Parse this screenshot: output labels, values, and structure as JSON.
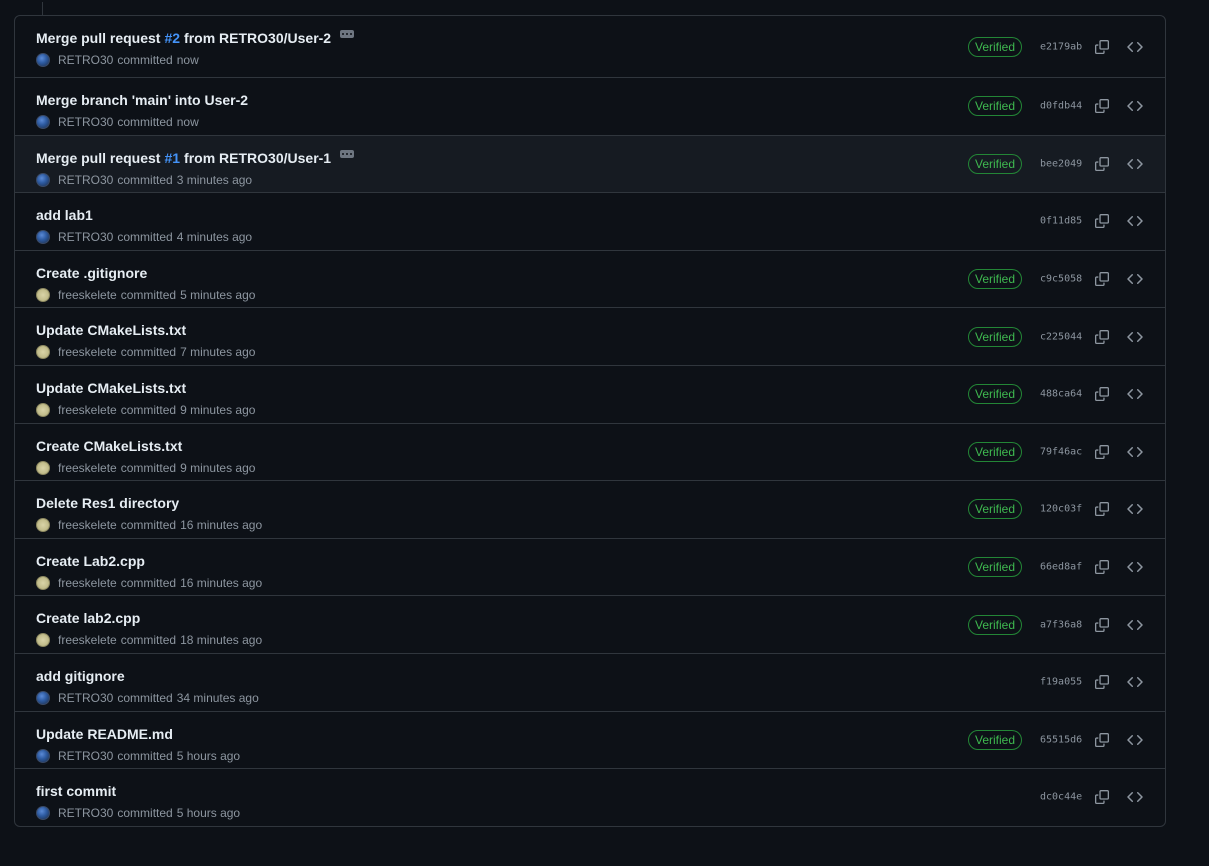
{
  "commits": [
    {
      "title_before": "Merge pull request",
      "pr_number": "#2",
      "title_after": "from RETRO30/User-2",
      "has_ellipsis": true,
      "author": "RETRO30",
      "avatar": "retro",
      "verb": "committed",
      "when": "now",
      "verified": "Verified",
      "sha": "e2179ab"
    },
    {
      "title_before": "Merge branch 'main' into User-2",
      "pr_number": "",
      "title_after": "",
      "has_ellipsis": false,
      "author": "RETRO30",
      "avatar": "retro",
      "verb": "committed",
      "when": "now",
      "verified": "Verified",
      "sha": "d0fdb44"
    },
    {
      "title_before": "Merge pull request",
      "pr_number": "#1",
      "title_after": "from RETRO30/User-1",
      "has_ellipsis": true,
      "author": "RETRO30",
      "avatar": "retro",
      "verb": "committed",
      "when": "3 minutes ago",
      "verified": "Verified",
      "sha": "bee2049",
      "hovered": true
    },
    {
      "title_before": "add lab1",
      "pr_number": "",
      "title_after": "",
      "has_ellipsis": false,
      "author": "RETRO30",
      "avatar": "retro",
      "verb": "committed",
      "when": "4 minutes ago",
      "verified": "",
      "sha": "0f11d85"
    },
    {
      "title_before": "Create .gitignore",
      "pr_number": "",
      "title_after": "",
      "has_ellipsis": false,
      "author": "freeskelete",
      "avatar": "free",
      "verb": "committed",
      "when": "5 minutes ago",
      "verified": "Verified",
      "sha": "c9c5058"
    },
    {
      "title_before": "Update CMakeLists.txt",
      "pr_number": "",
      "title_after": "",
      "has_ellipsis": false,
      "author": "freeskelete",
      "avatar": "free",
      "verb": "committed",
      "when": "7 minutes ago",
      "verified": "Verified",
      "sha": "c225044"
    },
    {
      "title_before": "Update CMakeLists.txt",
      "pr_number": "",
      "title_after": "",
      "has_ellipsis": false,
      "author": "freeskelete",
      "avatar": "free",
      "verb": "committed",
      "when": "9 minutes ago",
      "verified": "Verified",
      "sha": "488ca64"
    },
    {
      "title_before": "Create CMakeLists.txt",
      "pr_number": "",
      "title_after": "",
      "has_ellipsis": false,
      "author": "freeskelete",
      "avatar": "free",
      "verb": "committed",
      "when": "9 minutes ago",
      "verified": "Verified",
      "sha": "79f46ac"
    },
    {
      "title_before": "Delete Res1 directory",
      "pr_number": "",
      "title_after": "",
      "has_ellipsis": false,
      "author": "freeskelete",
      "avatar": "free",
      "verb": "committed",
      "when": "16 minutes ago",
      "verified": "Verified",
      "sha": "120c03f"
    },
    {
      "title_before": "Create Lab2.cpp",
      "pr_number": "",
      "title_after": "",
      "has_ellipsis": false,
      "author": "freeskelete",
      "avatar": "free",
      "verb": "committed",
      "when": "16 minutes ago",
      "verified": "Verified",
      "sha": "66ed8af"
    },
    {
      "title_before": "Create lab2.cpp",
      "pr_number": "",
      "title_after": "",
      "has_ellipsis": false,
      "author": "freeskelete",
      "avatar": "free",
      "verb": "committed",
      "when": "18 minutes ago",
      "verified": "Verified",
      "sha": "a7f36a8"
    },
    {
      "title_before": "add gitignore",
      "pr_number": "",
      "title_after": "",
      "has_ellipsis": false,
      "author": "RETRO30",
      "avatar": "retro",
      "verb": "committed",
      "when": "34 minutes ago",
      "verified": "",
      "sha": "f19a055"
    },
    {
      "title_before": "Update README.md",
      "pr_number": "",
      "title_after": "",
      "has_ellipsis": false,
      "author": "RETRO30",
      "avatar": "retro",
      "verb": "committed",
      "when": "5 hours ago",
      "verified": "Verified",
      "sha": "65515d6"
    },
    {
      "title_before": "first commit",
      "pr_number": "",
      "title_after": "",
      "has_ellipsis": false,
      "author": "RETRO30",
      "avatar": "retro",
      "verb": "committed",
      "when": "5 hours ago",
      "verified": "",
      "sha": "dc0c44e"
    }
  ],
  "colors": {
    "background": "#0d1117",
    "border": "#30363d",
    "verified": "#3fb950",
    "link": "#4493f8",
    "muted": "#8d96a0"
  },
  "icons": {
    "copy": "copy-icon",
    "browse": "code-icon",
    "ellipsis": "ellipsis-icon"
  }
}
